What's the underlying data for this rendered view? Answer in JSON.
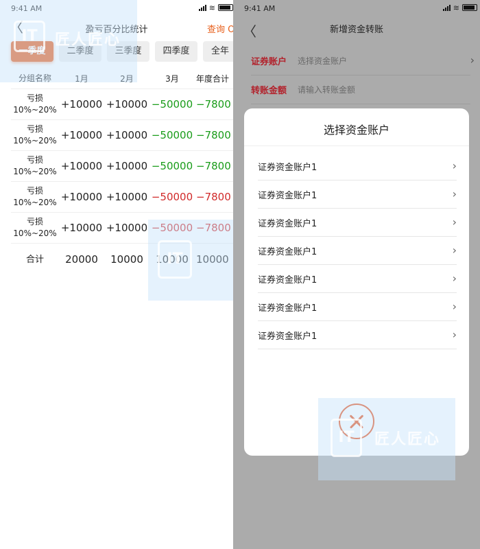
{
  "left": {
    "status_time": "9:41 AM",
    "nav_title": "盈亏百分比统计",
    "back_glyph": "〈",
    "query_label": "查询 O",
    "tabs": [
      "一季度",
      "二季度",
      "三季度",
      "四季度",
      "全年"
    ],
    "headers": [
      "分组名称",
      "1月",
      "2月",
      "3月",
      "年度合计"
    ],
    "rows": [
      {
        "group": "亏损\n10%~20%",
        "m1": "+10000",
        "m2": "+10000",
        "m3": "−50000",
        "total": "−7800",
        "status": "green"
      },
      {
        "group": "亏损\n10%~20%",
        "m1": "+10000",
        "m2": "+10000",
        "m3": "−50000",
        "total": "−7800",
        "status": "green"
      },
      {
        "group": "亏损\n10%~20%",
        "m1": "+10000",
        "m2": "+10000",
        "m3": "−50000",
        "total": "−7800",
        "status": "green"
      },
      {
        "group": "亏损\n10%~20%",
        "m1": "+10000",
        "m2": "+10000",
        "m3": "−50000",
        "total": "−7800",
        "status": "red"
      },
      {
        "group": "亏损\n10%~20%",
        "m1": "+10000",
        "m2": "+10000",
        "m3": "−50000",
        "total": "−7800",
        "status": "red"
      }
    ],
    "sum": {
      "label": "合计",
      "m1": "20000",
      "m2": "10000",
      "m3": "10000",
      "total": "10000"
    }
  },
  "right": {
    "status_time": "9:41 AM",
    "nav_title": "新增资金转账",
    "securities_label": "证券账户",
    "securities_placeholder": "选择资金账户",
    "amount_label": "转账金额",
    "amount_placeholder": "请输入转账金额",
    "modal_title": "选择资金账户",
    "accounts": [
      "证券资金账户1",
      "证券资金账户1",
      "证券资金账户1",
      "证券资金账户1",
      "证券资金账户1",
      "证券资金账户1",
      "证券资金账户1"
    ],
    "close_icon": "close-icon"
  },
  "watermark_text": "匠人匠心",
  "colors": {
    "accent": "#e9611f",
    "positive": "#1a9c1a",
    "negative": "#d12a2a",
    "label_red": "#b2222c",
    "overlay_gray": "#ababab"
  }
}
